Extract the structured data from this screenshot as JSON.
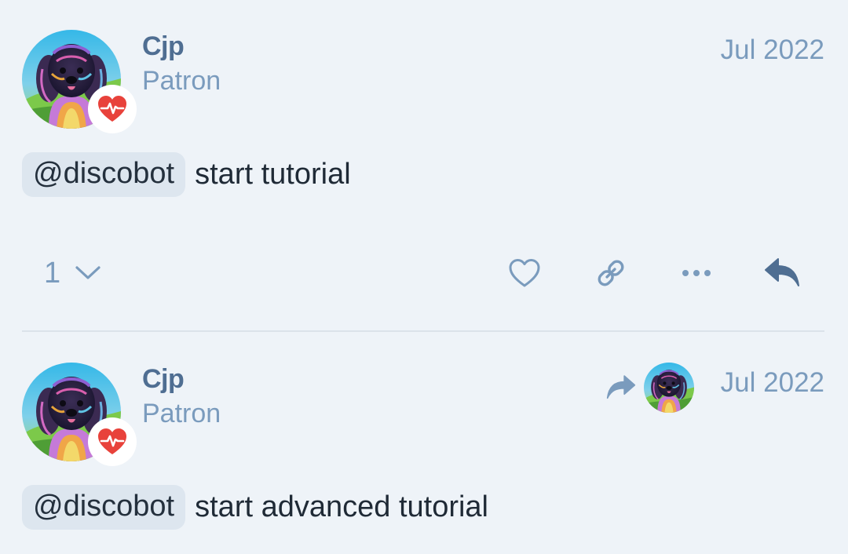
{
  "posts": [
    {
      "username": "Cjp",
      "user_title": "Patron",
      "date": "Jul 2022",
      "mention": "@discobot",
      "text": "start tutorial",
      "reply_count": "1",
      "icons": [
        "heart-icon",
        "link-icon",
        "more-icon",
        "reply-icon"
      ]
    },
    {
      "username": "Cjp",
      "user_title": "Patron",
      "date": "Jul 2022",
      "mention": "@discobot",
      "text": "start advanced tutorial"
    }
  ],
  "colors": {
    "background": "#eef3f8",
    "username": "#4f6e92",
    "muted": "#7a9bbd",
    "heart_flair": "#e8423b",
    "mention_bg": "#dde6ef"
  }
}
